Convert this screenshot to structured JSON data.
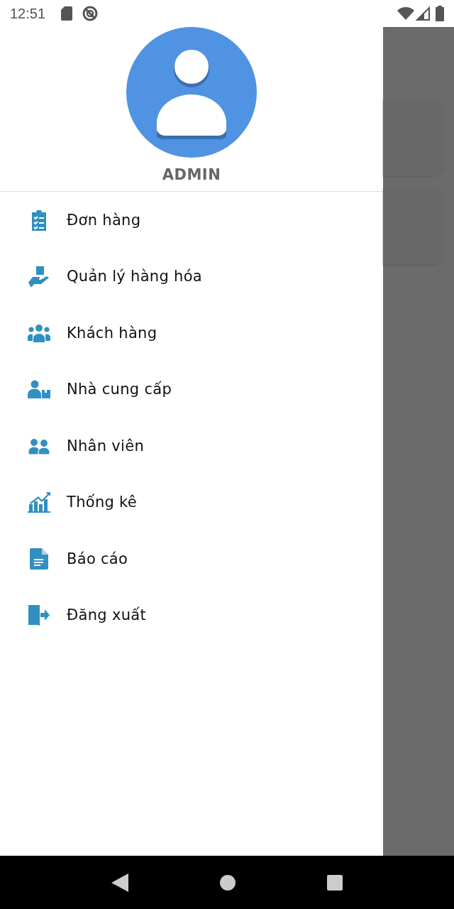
{
  "status_bar": {
    "time": "12:51"
  },
  "drawer": {
    "user_name": "ADMIN",
    "items": [
      {
        "label": "Đơn hàng",
        "kind": "orders"
      },
      {
        "label": "Quản lý hàng hóa",
        "kind": "goods"
      },
      {
        "label": "Khách hàng",
        "kind": "customers"
      },
      {
        "label": "Nhà cung cấp",
        "kind": "suppliers"
      },
      {
        "label": "Nhân viên",
        "kind": "staff"
      },
      {
        "label": "Thống kê",
        "kind": "stats"
      },
      {
        "label": "Báo cáo",
        "kind": "report"
      },
      {
        "label": "Đăng xuất",
        "kind": "logout"
      }
    ]
  }
}
